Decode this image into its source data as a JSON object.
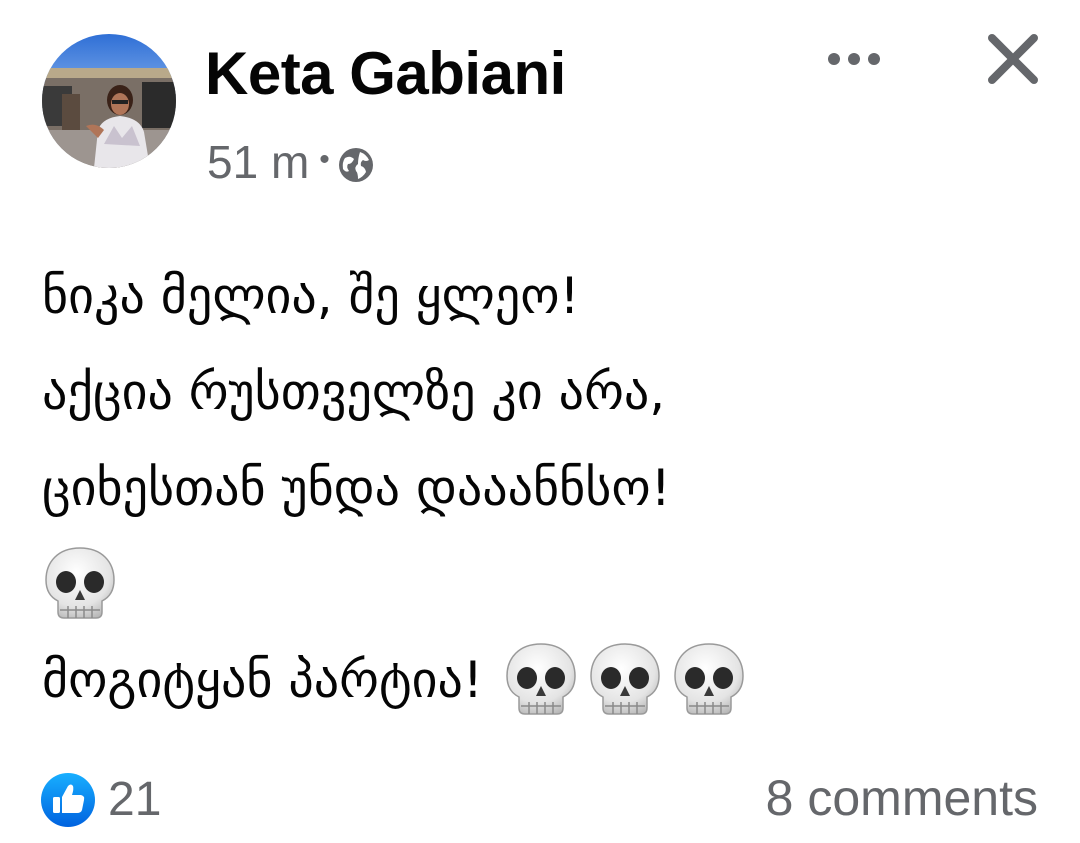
{
  "post": {
    "author_name": "Keta Gabiani",
    "timestamp": "51 m",
    "separator": "•",
    "privacy_icon": "globe-icon",
    "avatar_icon": "profile-photo",
    "more_icon": "more-horizontal-icon",
    "close_icon": "close-icon",
    "text_lines": [
      "ნიკა მელია, შე ყლეო!",
      "აქცია რუსთველზე კი არა,",
      "ციხესთან უნდა დააანნსო!",
      "მოგიტყან პარტია!"
    ],
    "emoji": "skull-emoji"
  },
  "footer": {
    "like_icon": "like-reaction-icon",
    "like_count": "21",
    "comments_label": "8 comments"
  },
  "colors": {
    "text_primary": "#050505",
    "text_secondary": "#65676b",
    "like_blue": "#1877f2",
    "background": "#ffffff"
  }
}
